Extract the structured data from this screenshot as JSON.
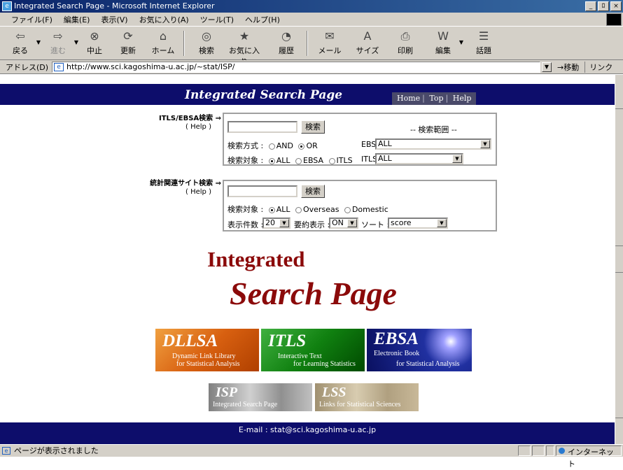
{
  "window": {
    "title": "Integrated Search Page - Microsoft Internet Explorer",
    "controls": [
      "_",
      "ﾛ",
      "×"
    ]
  },
  "menu": [
    "ファイル(F)",
    "編集(E)",
    "表示(V)",
    "お気に入り(A)",
    "ツール(T)",
    "ヘルプ(H)"
  ],
  "toolbar": {
    "back": "戻る",
    "forward": "進む",
    "stop": "中止",
    "refresh": "更新",
    "home": "ホーム",
    "search": "検索",
    "favorites": "お気に入り",
    "history": "履歴",
    "mail": "メール",
    "size": "サイズ",
    "print": "印刷",
    "edit": "編集",
    "discuss": "話題"
  },
  "address": {
    "label": "アドレス(D)",
    "url": "http://www.sci.kagoshima-u.ac.jp/~stat/ISP/",
    "go": "移動",
    "links": "リンク"
  },
  "banner": {
    "title": "Integrated Search Page",
    "links": [
      "Home",
      "Top",
      "Help"
    ]
  },
  "search1": {
    "label": "ITLS/EBSA検索 ⇒",
    "help": "( Help )",
    "button": "検索",
    "query": "",
    "range_label": "-- 検索範囲 --",
    "method_label": "検索方式 :",
    "method_and": "AND",
    "method_or": "OR",
    "ebsa_label": "EBSA",
    "ebsa_value": "ALL",
    "target_label": "検索対象 :",
    "target_all": "ALL",
    "target_ebsa": "EBSA",
    "target_itls": "ITLS",
    "itls_label": "ITLS",
    "itls_value": "ALL"
  },
  "search2": {
    "label": "統計関連サイト検索 ⇒",
    "help": "( Help )",
    "button": "検索",
    "query": "",
    "target_label": "検索対象 :",
    "target_all": "ALL",
    "target_overseas": "Overseas",
    "target_domestic": "Domestic",
    "count_label": "表示件数 :",
    "count_value": "20",
    "summary_label": "要約表示 :",
    "summary_value": "ON",
    "sort_label": "ソート :",
    "sort_value": "score"
  },
  "hero": {
    "line1": "Integrated",
    "line2": "Search Page"
  },
  "tiles": {
    "dllsa": {
      "name": "DLLSA",
      "line1": "Dynamic Link Library",
      "line2": "for Statistical Analysis"
    },
    "itls": {
      "name": "ITLS",
      "line1": "Interactive Text",
      "line2": "for Learning Statistics"
    },
    "ebsa": {
      "name": "EBSA",
      "line1": "Electronic Book",
      "line2": "for Statistical Analysis"
    },
    "isp": {
      "name": "ISP",
      "line1": "Integrated Search Page"
    },
    "lss": {
      "name": "LSS",
      "line1": "Links for Statistical Sciences"
    }
  },
  "footer": {
    "email": "E-mail : stat@sci.kagoshima-u.ac.jp"
  },
  "status": {
    "text": "ページが表示されました",
    "zone": "インターネット"
  }
}
